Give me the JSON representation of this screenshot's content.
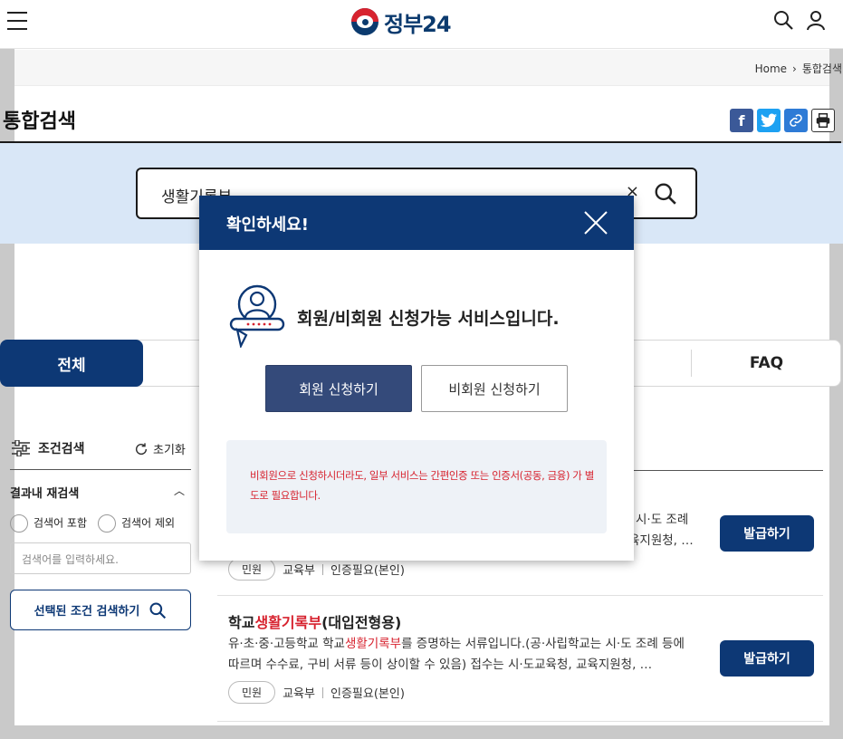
{
  "header": {
    "logo_text": "정부24",
    "icons": [
      "menu-icon",
      "search-icon",
      "user-icon"
    ]
  },
  "breadcrumb": {
    "home": "Home",
    "separator": "›",
    "current": "통합검색"
  },
  "page": {
    "title": "통합검색",
    "share_icons": [
      "facebook-icon",
      "twitter-icon",
      "link-icon",
      "print-icon"
    ]
  },
  "search": {
    "value": "생활기록부",
    "clear": "×"
  },
  "tabs": {
    "all": "전체",
    "faq": "FAQ"
  },
  "sidebar": {
    "heading": "조건검색",
    "reset": "초기화",
    "refine_title": "결과내 재검색",
    "include": "검색어 포함",
    "exclude": "검색어 제외",
    "placeholder": "검색어를 입력하세요.",
    "submit": "선택된 조건 검색하기"
  },
  "results": [
    {
      "desc_partial_line1": "시·도 조례",
      "desc_partial_line2": "육지원청, …",
      "tag": "민원",
      "org": "교육부",
      "auth": "인증필요(본인)",
      "button": "발급하기"
    },
    {
      "title_pre": "학교",
      "title_hl": "생활기록부",
      "title_post": "(대입전형용)",
      "desc_pre": "유·초·중·고등학교 학교",
      "desc_hl": "생활기록부",
      "desc_post": "를 증명하는 서류입니다.(공·사립학교는 시·도 조례 등에 따르며 수수료, 구비 서류 등이 상이할 수 있음) 접수는 시·도교육청, 교육지원청, …",
      "tag": "민원",
      "org": "교육부",
      "auth": "인증필요(본인)",
      "button": "발급하기"
    }
  ],
  "modal": {
    "title": "확인하세요!",
    "message": "회원/비회원 신청가능 서비스입니다.",
    "member_button": "회원 신청하기",
    "guest_button": "비회원 신청하기",
    "notice": "비회원으로 신청하시더라도, 일부 서비스는 간편인증 또는 인증서(공동, 금융) 가 별도로 필요합니다.",
    "colors": {
      "header": "#0d3875",
      "primary_button": "#344a7a",
      "notice_text": "#d7232f"
    }
  }
}
